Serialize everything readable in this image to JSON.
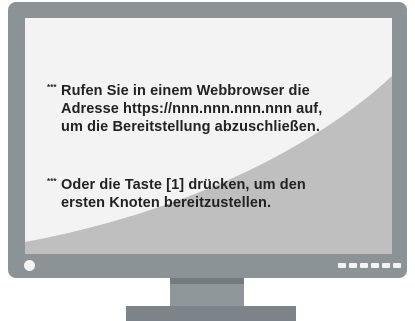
{
  "screen": {
    "message_1": {
      "marker": "***",
      "lines": [
        "Rufen Sie in einem Webbrowser die",
        "Adresse https://nnn.nnn.nnn.nnn auf,",
        "um die Bereitstellung abzuschließen."
      ]
    },
    "message_2": {
      "marker": "***",
      "lines": [
        "Oder die Taste [1] drücken, um den",
        "ersten Knoten bereitzustellen."
      ]
    }
  },
  "colors": {
    "frame": "#8c9397",
    "screen_shade": "#bfbfbf",
    "screen_light": "#f3f3f3",
    "text": "#222222",
    "stand": "#7d8489"
  },
  "icons": {
    "power_led": "power-indicator-icon",
    "control_buttons": "monitor-buttons-icon"
  }
}
